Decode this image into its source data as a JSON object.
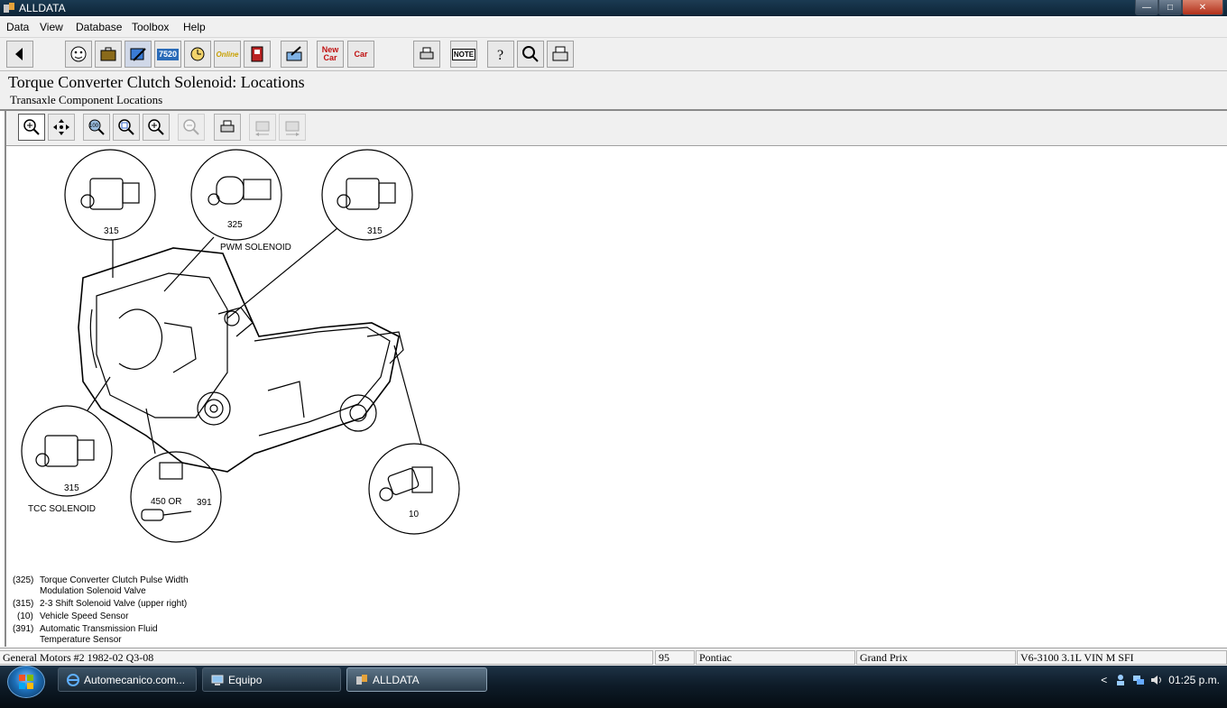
{
  "window": {
    "title": "ALLDATA",
    "minimize": "—",
    "maximize": "□",
    "close": "✕"
  },
  "menu": [
    "Data",
    "View",
    "Database",
    "Toolbox",
    "Help"
  ],
  "toolbar": {
    "online_label": "Online",
    "code_label": "7520",
    "new_car_label": "New Car",
    "car_label": "Car",
    "note_label": "NOTE"
  },
  "header": {
    "title": "Torque Converter Clutch Solenoid:  Locations",
    "subtitle": "Transaxle Component Locations"
  },
  "diagram": {
    "labels": {
      "l315a": "315",
      "l325": "325",
      "pwm": "PWM SOLENOID",
      "l315b": "315",
      "l315c": "315",
      "tcc": "TCC SOLENOID",
      "l450": "450  OR",
      "l391": "391",
      "l10": "10"
    },
    "legend": [
      {
        "code": "(325)",
        "desc": "Torque Converter Clutch Pulse Width Modulation Solenoid Valve"
      },
      {
        "code": "(315)",
        "desc": "2-3 Shift Solenoid Valve (upper right)"
      },
      {
        "code": "(10)",
        "desc": "Vehicle Speed Sensor"
      },
      {
        "code": "(391)",
        "desc": "Automatic Transmission Fluid Temperature Sensor"
      }
    ]
  },
  "statusbar": {
    "database": "General Motors #2 1982-02 Q3-08",
    "year": "95",
    "make": "Pontiac",
    "model": "Grand Prix",
    "engine": "V6-3100 3.1L VIN M SFI"
  },
  "taskbar": {
    "items": [
      "Automecanico.com...",
      "Equipo",
      "ALLDATA"
    ],
    "clock": "01:25 p.m.",
    "tray_arrow": "<"
  }
}
